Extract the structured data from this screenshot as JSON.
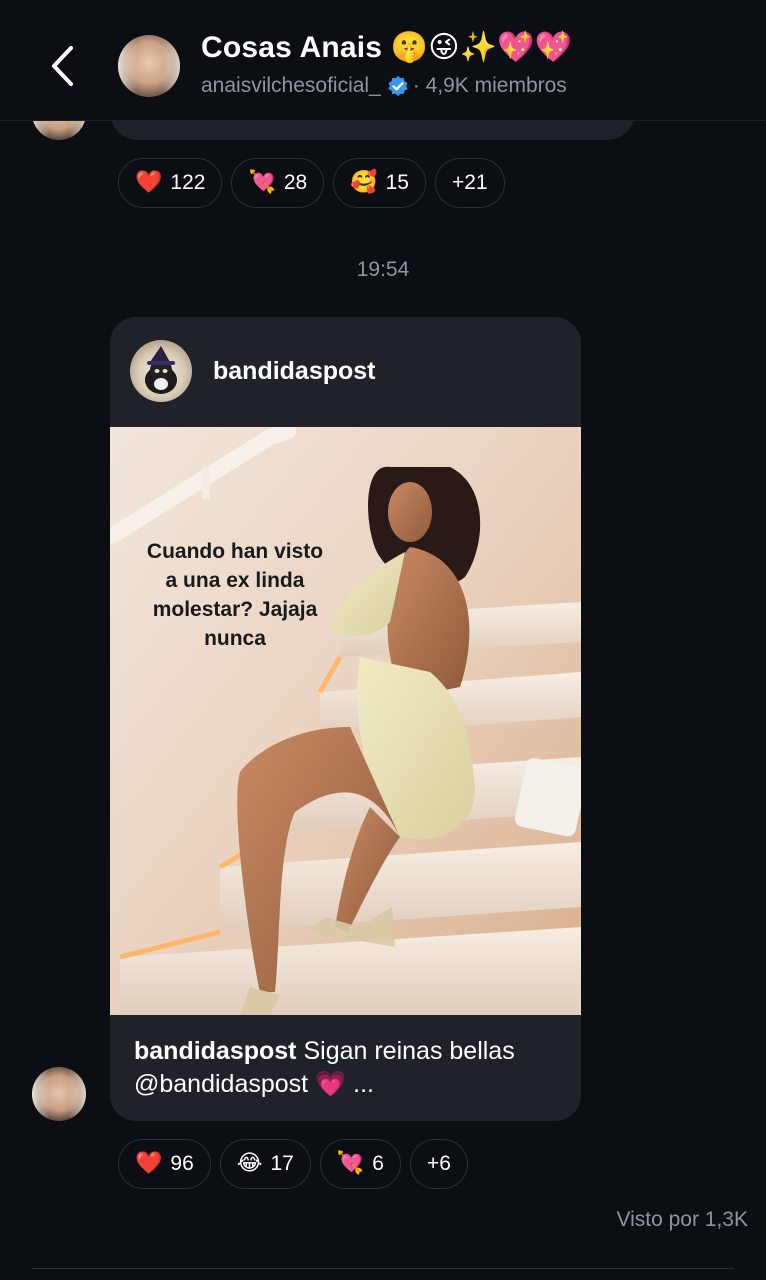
{
  "header": {
    "title": "Cosas Anais 🤫😜✨💖💖",
    "username": "anaisvilchesoficial_",
    "members": "· 4,9K miembros"
  },
  "prev_message": {
    "reactions": [
      {
        "emoji": "❤️",
        "count": "122"
      },
      {
        "emoji": "💘",
        "count": "28"
      },
      {
        "emoji": "🥰",
        "count": "15"
      },
      {
        "emoji": "",
        "count": "+21"
      }
    ]
  },
  "timestamp": "19:54",
  "post": {
    "username": "bandidaspost",
    "image_text": "Cuando han visto a una ex linda molestar? Jajaja nunca",
    "caption_user": "bandidaspost",
    "caption_text": " Sigan reinas bellas @bandidaspost 💗 ...",
    "reactions": [
      {
        "emoji": "❤️",
        "count": "96"
      },
      {
        "emoji": "😂",
        "count": "17"
      },
      {
        "emoji": "💘",
        "count": "6"
      },
      {
        "emoji": "",
        "count": "+6"
      }
    ]
  },
  "seen_by": "Visto por 1,3K",
  "colors": {
    "background": "#0b0e13",
    "bubble": "#1f2228",
    "muted_text": "#8e959e",
    "verified_blue": "#3897f0"
  }
}
